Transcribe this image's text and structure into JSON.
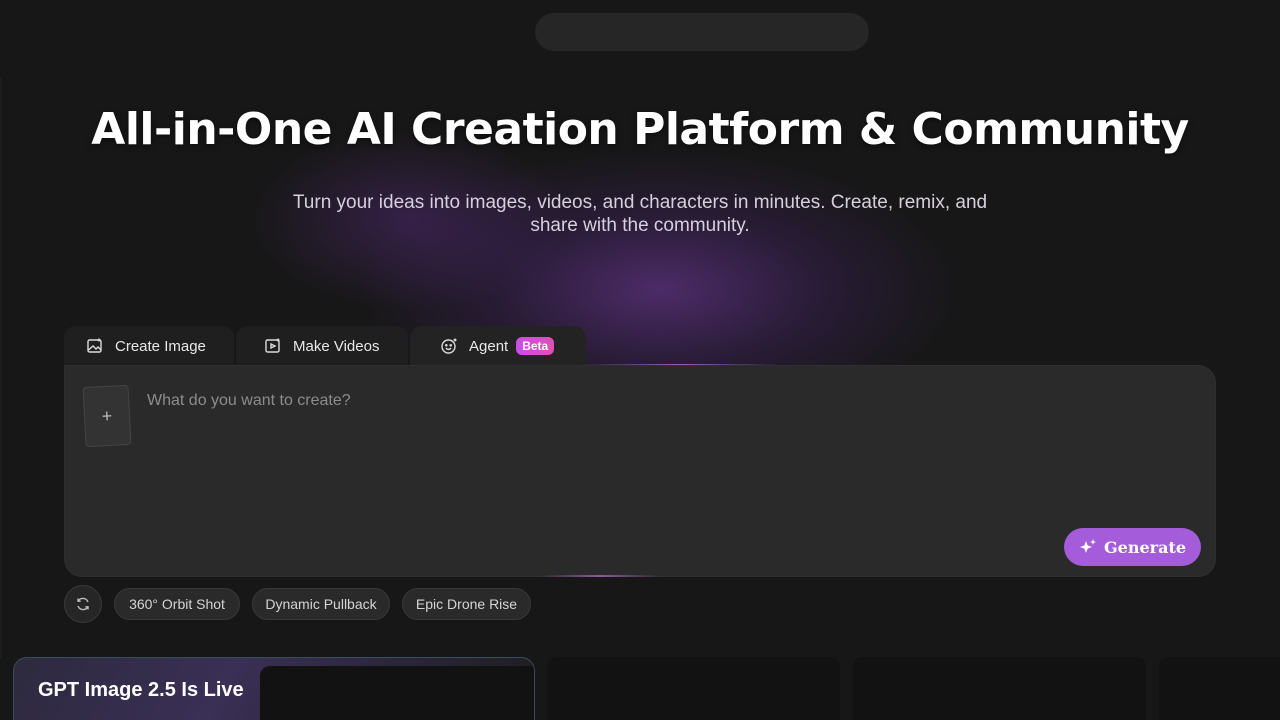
{
  "hero": {
    "title": "All-in-One AI Creation Platform & Community",
    "subtitle": "Turn your ideas into images, videos, and characters in minutes. Create, remix, and share with the community."
  },
  "tabs": [
    {
      "label": "Create Image",
      "icon": "image-icon"
    },
    {
      "label": "Make Videos",
      "icon": "video-icon"
    },
    {
      "label": "Agent",
      "icon": "agent-icon",
      "badge": "Beta"
    }
  ],
  "composer": {
    "upload_label": "+",
    "placeholder": "What do you want to create?",
    "value": "",
    "generate_label": "Generate"
  },
  "chips": [
    {
      "label": "360° Orbit Shot"
    },
    {
      "label": "Dynamic Pullback"
    },
    {
      "label": "Epic Drone Rise"
    }
  ],
  "promo": {
    "title": "GPT Image 2.5 Is Live"
  },
  "colors": {
    "background": "#171717",
    "accent": "#a45cdb",
    "beta_badge": "#d44fd0"
  }
}
